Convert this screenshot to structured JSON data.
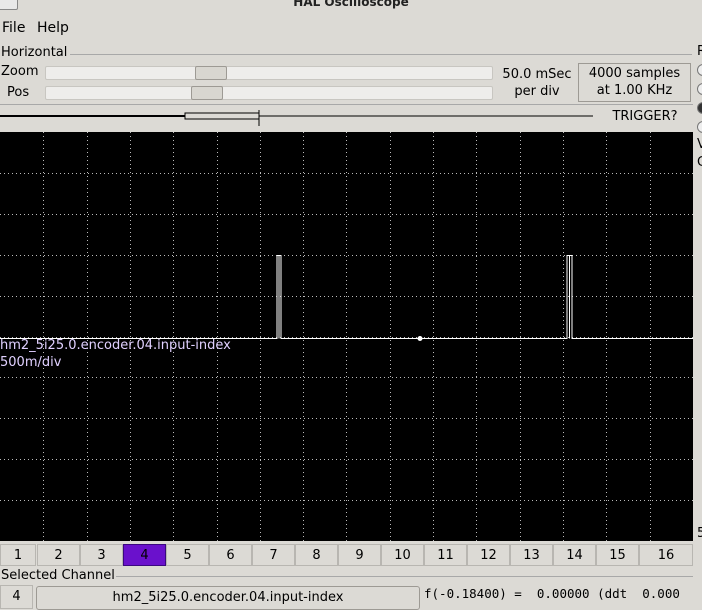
{
  "window": {
    "title": "HAL Oscilloscope"
  },
  "menu": {
    "file": "File",
    "help": "Help"
  },
  "horizontal": {
    "group_label": "Horizontal",
    "zoom_label": "Zoom",
    "pos_label": "Pos",
    "zoom_value": 0.36,
    "pos_value": 0.35,
    "time_per_div": "50.0 mSec",
    "per_div": "per div",
    "samples": "4000 samples",
    "rate": "at 1.00 KHz"
  },
  "trigger": {
    "button": "TRIGGER?"
  },
  "scope": {
    "channel_name": "hm2_5i25.0.encoder.04.input-index",
    "scale": "500m/div",
    "colors": {
      "background": "#000000",
      "grid": "#bbbbbb",
      "trace": "#ffffff",
      "label": "#e0d0ff"
    }
  },
  "channels": [
    "1",
    "2",
    "3",
    "4",
    "5",
    "6",
    "7",
    "8",
    "9",
    "10",
    "11",
    "12",
    "13",
    "14",
    "15",
    "16"
  ],
  "selected_channel_index": 3,
  "selected": {
    "group_label": "Selected Channel",
    "number": "4",
    "name": "hm2_5i25.0.encoder.04.input-index",
    "readout": "f(-0.18400) =  0.00000 (ddt  0.000"
  },
  "right_panel": {
    "label_r": "R",
    "label_v": "V",
    "label_o": "C",
    "label_5": "5"
  }
}
